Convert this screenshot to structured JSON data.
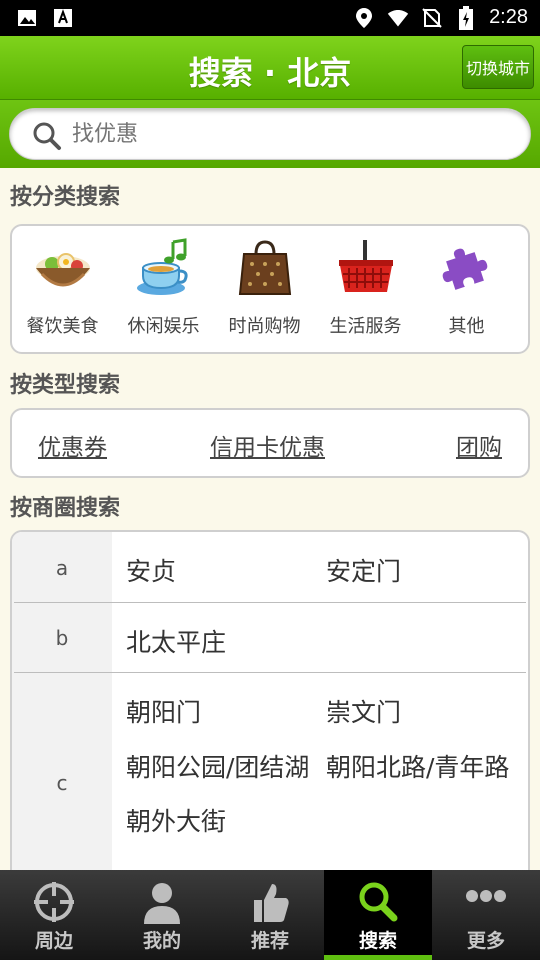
{
  "status_bar": {
    "time": "2:28",
    "left_icons": [
      "image-icon",
      "font-download-icon"
    ],
    "right_icons": [
      "location-icon",
      "wifi-icon",
      "no-sim-icon",
      "battery-charging-icon"
    ]
  },
  "header": {
    "title": "搜索 · 北京",
    "switch_city_label": "切换城市"
  },
  "search": {
    "placeholder": "找优惠",
    "icon": "search-icon"
  },
  "category_section": {
    "title": "按分类搜索",
    "items": [
      {
        "label": "餐饮美食",
        "icon": "food-bowl-icon"
      },
      {
        "label": "休闲娱乐",
        "icon": "teacup-music-icon"
      },
      {
        "label": "时尚购物",
        "icon": "shopping-bag-icon"
      },
      {
        "label": "生活服务",
        "icon": "basket-icon"
      },
      {
        "label": "其他",
        "icon": "puzzle-icon"
      }
    ]
  },
  "type_section": {
    "title": "按类型搜索",
    "links": [
      "优惠券",
      "信用卡优惠",
      "团购"
    ]
  },
  "district_section": {
    "title": "按商圈搜索",
    "groups": [
      {
        "letter": "a",
        "names": [
          "安贞",
          "安定门"
        ]
      },
      {
        "letter": "b",
        "names": [
          "北太平庄"
        ]
      },
      {
        "letter": "c",
        "names": [
          "朝阳门",
          "崇文门",
          "朝阳公园/团结湖",
          "朝阳北路/青年路",
          "朝外大街"
        ]
      }
    ]
  },
  "bottom_nav": {
    "items": [
      {
        "label": "周边",
        "icon": "crosshair-icon",
        "active": false
      },
      {
        "label": "我的",
        "icon": "person-icon",
        "active": false
      },
      {
        "label": "推荐",
        "icon": "thumbs-up-icon",
        "active": false
      },
      {
        "label": "搜索",
        "icon": "search-icon",
        "active": true
      },
      {
        "label": "更多",
        "icon": "more-dots-icon",
        "active": false
      }
    ]
  },
  "colors": {
    "accent_green": "#5fbf10",
    "background": "#fbf9ea"
  }
}
